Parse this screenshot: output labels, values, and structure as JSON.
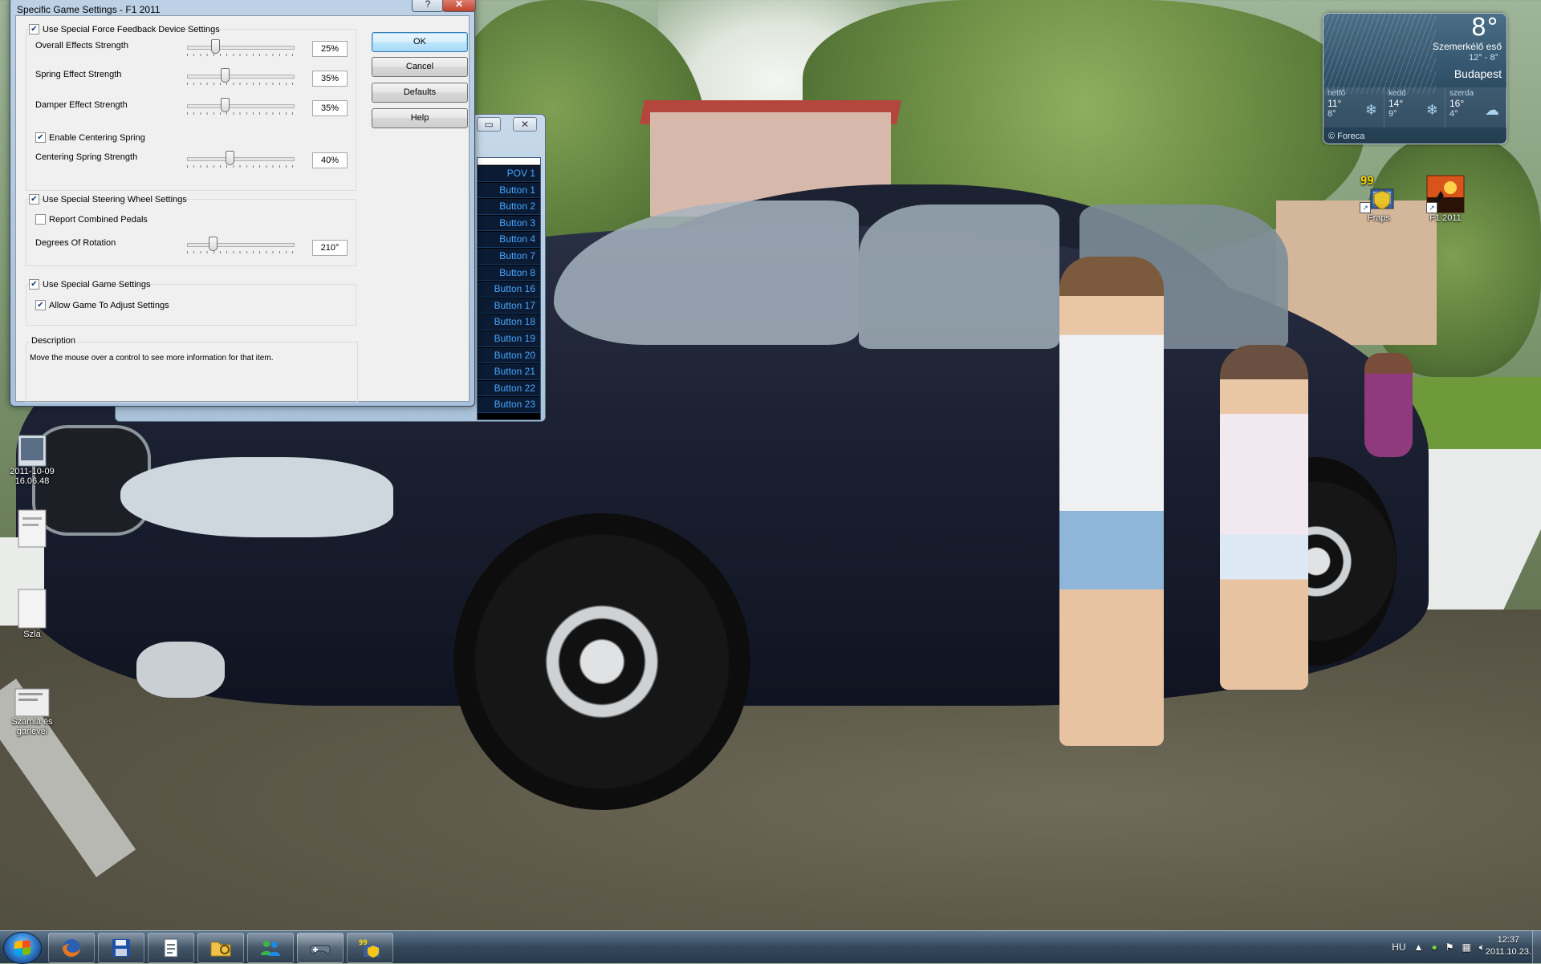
{
  "dialog": {
    "title": "Specific Game Settings - F1 2011",
    "help_glyph": "?",
    "close_glyph": "✕",
    "force_feedback": {
      "checkbox_label": "Use Special Force Feedback Device Settings",
      "checked": true,
      "overall": {
        "label": "Overall Effects Strength",
        "value": "25%",
        "level": 0.25
      },
      "spring": {
        "label": "Spring Effect Strength",
        "value": "35%",
        "level": 0.35
      },
      "damper": {
        "label": "Damper Effect Strength",
        "value": "35%",
        "level": 0.35
      },
      "centering_checkbox": "Enable Centering Spring",
      "centering_checked": true,
      "centering": {
        "label": "Centering Spring Strength",
        "value": "40%",
        "level": 0.4
      }
    },
    "steering": {
      "checkbox_label": "Use Special Steering Wheel Settings",
      "checked": true,
      "combined_pedals": "Report Combined Pedals",
      "combined_checked": false,
      "rotation": {
        "label": "Degrees Of Rotation",
        "value": "210°",
        "level": 0.22
      }
    },
    "game": {
      "checkbox_label": "Use Special Game Settings",
      "checked": true,
      "allow_label": "Allow Game To Adjust Settings",
      "allow_checked": true
    },
    "description": {
      "title": "Description",
      "text": "Move the mouse over a control to see more information for that item."
    },
    "buttons": {
      "ok": "OK",
      "cancel": "Cancel",
      "defaults": "Defaults",
      "help": "Help"
    }
  },
  "back_window": {
    "minimize_glyph": "▭",
    "close_glyph": "✕",
    "button_list": [
      "POV 1",
      "Button 1",
      "Button 2",
      "Button 3",
      "Button 4",
      "Button 7",
      "Button 8",
      "Button 16",
      "Button 17",
      "Button 18",
      "Button 19",
      "Button 20",
      "Button 21",
      "Button 22",
      "Button 23"
    ]
  },
  "weather": {
    "temperature": "8°",
    "condition": "Szemerkélő eső",
    "range": "12° - 8°",
    "city": "Budapest",
    "forecast": [
      {
        "day": "hétfő",
        "high": "11°",
        "low": "8°"
      },
      {
        "day": "kedd",
        "high": "14°",
        "low": "9°"
      },
      {
        "day": "szerda",
        "high": "16°",
        "low": "4°"
      }
    ],
    "provider": "© Foreca"
  },
  "desktop_icons": [
    {
      "label": "Fraps",
      "badge": "99"
    },
    {
      "label": "F1 2011"
    },
    {
      "label": "2011-10-09\n16.06.48"
    },
    {
      "label": "Szla"
    },
    {
      "label": "Számla és garlevél"
    }
  ],
  "taskbar": {
    "items": [
      "firefox",
      "save-disk",
      "notepad",
      "explorer",
      "messenger",
      "gamepad",
      "fraps"
    ],
    "language": "HU",
    "clock_time": "12:37",
    "clock_date": "2011.10.23."
  },
  "colors": {
    "list_text": "#47a6ff",
    "default_button": "#3c7fb1",
    "close_button": "#c1412c"
  }
}
